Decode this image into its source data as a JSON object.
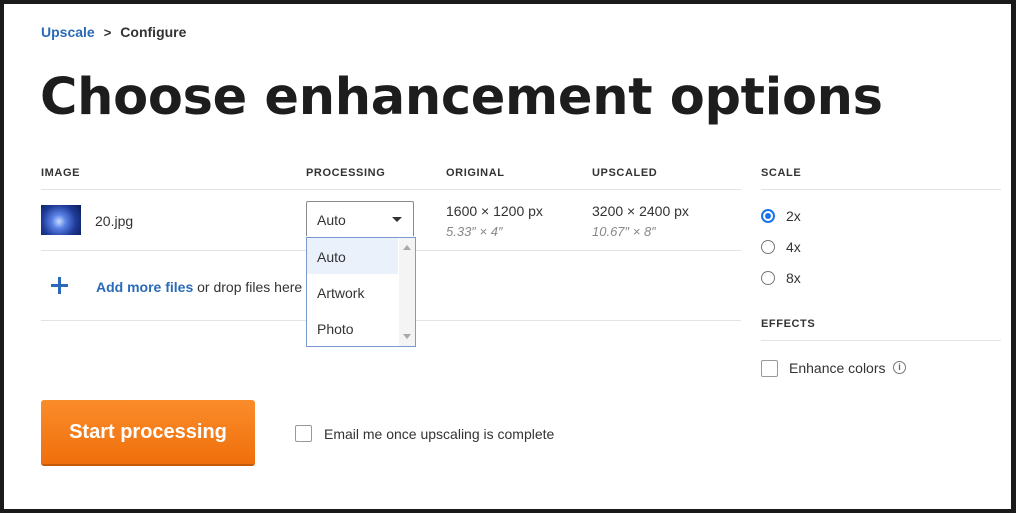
{
  "breadcrumb": {
    "parent": "Upscale",
    "separator": ">",
    "current": "Configure"
  },
  "page_title": "Choose enhancement options",
  "table": {
    "headers": {
      "image": "IMAGE",
      "processing": "PROCESSING",
      "original": "ORIGINAL",
      "upscaled": "UPSCALED"
    },
    "row": {
      "filename": "20.jpg",
      "processing_value": "Auto",
      "original_px": "1600 × 1200 px",
      "original_in": "5.33″ × 4″",
      "upscaled_px": "3200 × 2400 px",
      "upscaled_in": "10.67″ × 8″"
    }
  },
  "processing_options": [
    "Auto",
    "Artwork",
    "Photo"
  ],
  "processing_selected": "Auto",
  "add_files": {
    "link": "Add more files",
    "text": "or drop files here"
  },
  "scale": {
    "label": "SCALE",
    "options": [
      "2x",
      "4x",
      "8x"
    ],
    "selected": "2x"
  },
  "effects": {
    "label": "EFFECTS",
    "enhance_colors": "Enhance colors",
    "enhance_colors_checked": false
  },
  "info_icon_glyph": "i",
  "start_button": "Start processing",
  "email_option": {
    "label": "Email me once upscaling is complete",
    "checked": false
  },
  "colors": {
    "accent": "#2a6ab8",
    "button": "#f57c18",
    "radio": "#1a73e8"
  }
}
